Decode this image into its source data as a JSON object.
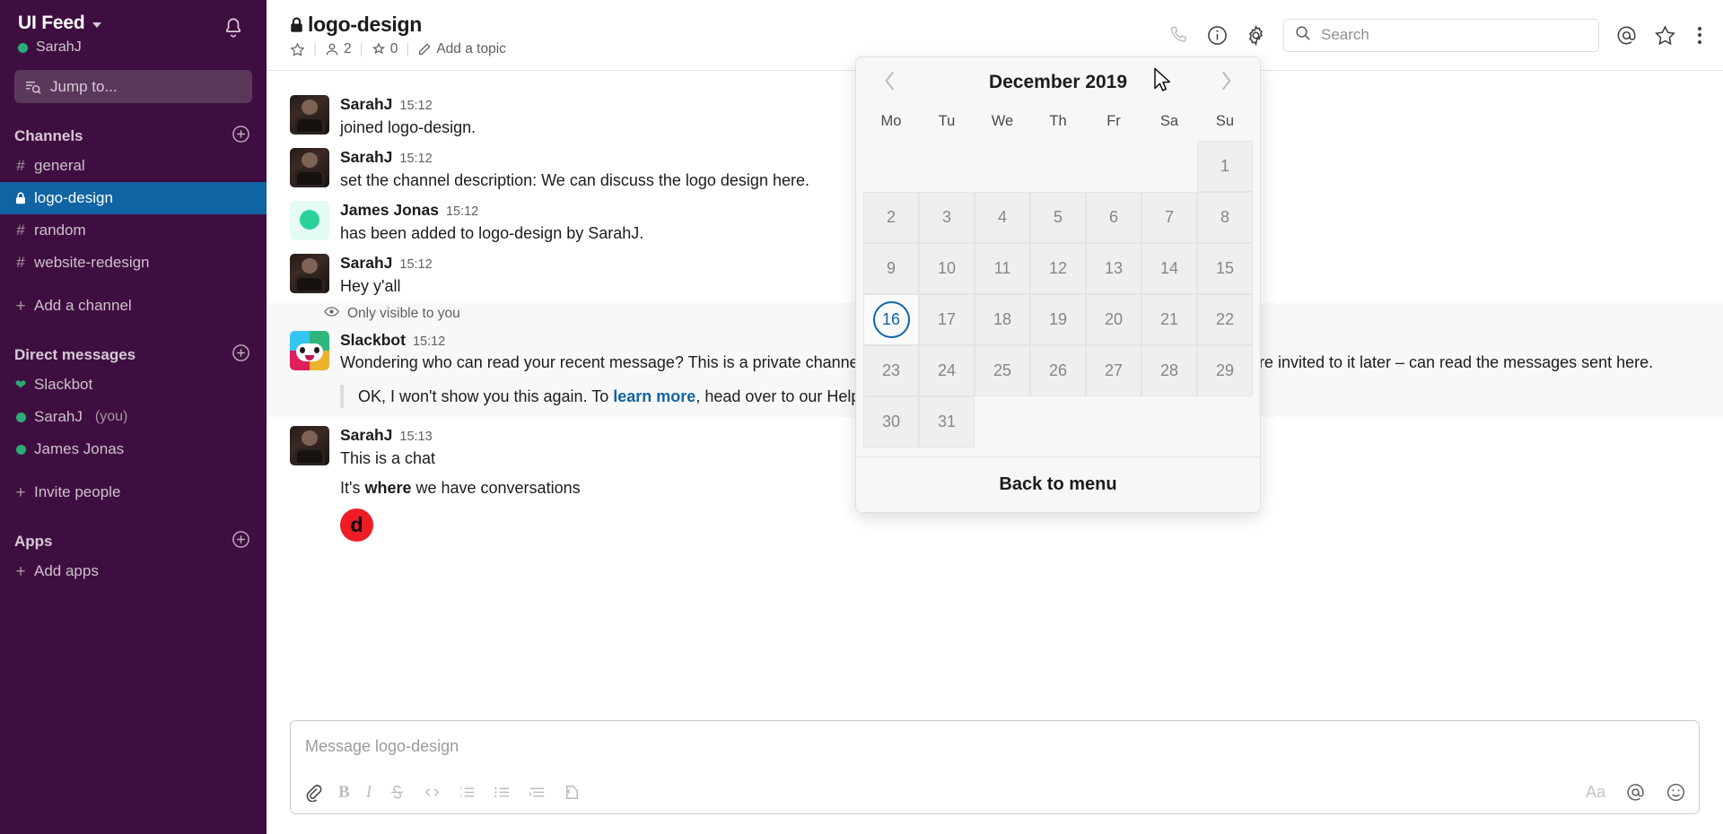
{
  "sidebar": {
    "workspace_name": "UI Feed",
    "workspace_chevron": "chevron-down-icon",
    "current_user": "SarahJ",
    "notifications_icon": "bell-icon",
    "jump_to_label": "Jump to...",
    "channels_section": {
      "title": "Channels",
      "add_icon": "plus-circle-icon",
      "items": [
        {
          "label": "general",
          "prefix": "#",
          "type": "public",
          "active": false
        },
        {
          "label": "logo-design",
          "prefix": "lock",
          "type": "private",
          "active": true
        },
        {
          "label": "random",
          "prefix": "#",
          "type": "public",
          "active": false
        },
        {
          "label": "website-redesign",
          "prefix": "#",
          "type": "public",
          "active": false
        }
      ],
      "add_channel_label": "Add a channel"
    },
    "dm_section": {
      "title": "Direct messages",
      "add_icon": "plus-circle-icon",
      "items": [
        {
          "label": "Slackbot",
          "status": "heart",
          "suffix": ""
        },
        {
          "label": "SarahJ",
          "status": "online",
          "suffix": "(you)"
        },
        {
          "label": "James Jonas",
          "status": "online",
          "suffix": ""
        }
      ],
      "invite_label": "Invite people"
    },
    "apps_section": {
      "title": "Apps",
      "add_icon": "plus-circle-icon",
      "add_apps_label": "Add apps"
    }
  },
  "topbar": {
    "channel_name": "logo-design",
    "channel_lock_icon": "lock-icon",
    "star_icon": "star-outline-icon",
    "members_icon": "person-icon",
    "members_count": "2",
    "pins_icon": "pin-icon",
    "pins_count": "0",
    "topic_icon": "pencil-icon",
    "topic_label": "Add a topic",
    "separator": "|",
    "call_icon": "phone-icon",
    "info_icon": "info-circle-icon",
    "settings_icon": "gear-icon",
    "search": {
      "icon": "search-icon",
      "placeholder": "Search",
      "value": ""
    },
    "mentions_icon": "at-mention-icon",
    "saved_icon": "star-outline-icon",
    "more_icon": "more-vertical-icon"
  },
  "messages": [
    {
      "author": "SarahJ",
      "time": "15:12",
      "avatar": "photo-sarah",
      "text": "joined logo-design.",
      "bold_word": "",
      "text_after": ""
    },
    {
      "author": "SarahJ",
      "time": "15:12",
      "avatar": "photo-sarah",
      "text": "set the channel description: We can discuss the logo design here.",
      "bold_word": "",
      "text_after": ""
    },
    {
      "author": "James Jonas",
      "time": "15:12",
      "avatar": "avatar-james",
      "text": "has been added to logo-design by SarahJ.",
      "bold_word": "",
      "text_after": ""
    },
    {
      "author": "SarahJ",
      "time": "15:12",
      "avatar": "photo-sarah",
      "text": "Hey y'all",
      "bold_word": "",
      "text_after": ""
    }
  ],
  "ephemeral": {
    "only_visible_icon": "eye-icon",
    "only_visible_label": "Only visible to you",
    "author": "Slackbot",
    "time": "15:12",
    "avatar": "slackbot-icon",
    "body": "Wondering who can read your recent message? This is a private channel, so only people who are in this channel now – or who are invited to it later – can read the messages sent here.",
    "quote_before": "OK, I won't show you this again. To ",
    "quote_link": "learn more",
    "quote_after": ", head over to our Help Center."
  },
  "last_message": {
    "author": "SarahJ",
    "time": "15:13",
    "avatar": "photo-sarah",
    "line1": "This is a chat",
    "line2_before": "It's ",
    "line2_bold": "where",
    "line2_after": " we have conversations",
    "reaction_label": "d"
  },
  "composer": {
    "placeholder": "Message logo-design",
    "value": "",
    "tools_left": [
      {
        "name": "attach-icon",
        "label": ""
      },
      {
        "name": "bold-icon",
        "label": "B"
      },
      {
        "name": "italic-icon",
        "label": "I"
      },
      {
        "name": "strikethrough-icon",
        "label": ""
      },
      {
        "name": "code-icon",
        "label": ""
      },
      {
        "name": "ordered-list-icon",
        "label": ""
      },
      {
        "name": "bulleted-list-icon",
        "label": ""
      },
      {
        "name": "blockquote-icon",
        "label": ""
      },
      {
        "name": "code-block-icon",
        "label": ""
      }
    ],
    "tools_right": [
      {
        "name": "format-text-icon",
        "label": "Aa"
      },
      {
        "name": "at-mention-icon",
        "label": ""
      },
      {
        "name": "emoji-icon",
        "label": ""
      }
    ]
  },
  "datepicker": {
    "prev_icon": "chevron-left-icon",
    "next_icon": "chevron-right-icon",
    "title": "December 2019",
    "weekdays": [
      "Mo",
      "Tu",
      "We",
      "Th",
      "Fr",
      "Sa",
      "Su"
    ],
    "leading_blanks": 6,
    "days": [
      1,
      2,
      3,
      4,
      5,
      6,
      7,
      8,
      9,
      10,
      11,
      12,
      13,
      14,
      15,
      16,
      17,
      18,
      19,
      20,
      21,
      22,
      23,
      24,
      25,
      26,
      27,
      28,
      29,
      30,
      31
    ],
    "today": 16,
    "footer_label": "Back to menu"
  },
  "colors": {
    "sidebar_bg": "#3F0E40",
    "active_channel_bg": "#1164A3",
    "online_green": "#2BAC76",
    "link_blue": "#1264A3",
    "today_blue": "#1264A3",
    "reaction_red": "#EE1C25"
  }
}
